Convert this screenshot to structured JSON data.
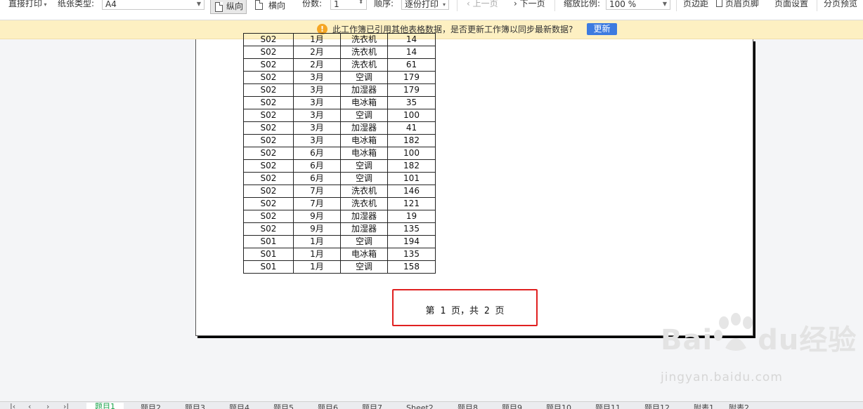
{
  "toolbar": {
    "print_direct": "直接打印",
    "paper_type_label": "纸张类型:",
    "paper_type_value": "A4",
    "portrait": "纵向",
    "landscape": "横向",
    "copies_label": "份数:",
    "copies_value": "1",
    "order_label": "顺序:",
    "order_value": "逐份打印",
    "prev_page": "上一页",
    "next_page": "下一页",
    "zoom_label": "缩放比例:",
    "zoom_value": "100 %",
    "margins": "页边距",
    "header_footer": "页眉页脚",
    "page_setup": "页面设置",
    "page_break_preview": "分页预览"
  },
  "notification": {
    "icon": "warning-circle-icon",
    "message": "此工作簿已引用其他表格数据，是否更新工作簿以同步最新数据?",
    "button": "更新"
  },
  "table": {
    "rows": [
      [
        "S02",
        "1月",
        "洗衣机",
        "14"
      ],
      [
        "S02",
        "2月",
        "洗衣机",
        "14"
      ],
      [
        "S02",
        "2月",
        "洗衣机",
        "61"
      ],
      [
        "S02",
        "3月",
        "空调",
        "179"
      ],
      [
        "S02",
        "3月",
        "加湿器",
        "179"
      ],
      [
        "S02",
        "3月",
        "电冰箱",
        "35"
      ],
      [
        "S02",
        "3月",
        "空调",
        "100"
      ],
      [
        "S02",
        "3月",
        "加湿器",
        "41"
      ],
      [
        "S02",
        "3月",
        "电冰箱",
        "182"
      ],
      [
        "S02",
        "6月",
        "电冰箱",
        "100"
      ],
      [
        "S02",
        "6月",
        "空调",
        "182"
      ],
      [
        "S02",
        "6月",
        "空调",
        "101"
      ],
      [
        "S02",
        "7月",
        "洗衣机",
        "146"
      ],
      [
        "S02",
        "7月",
        "洗衣机",
        "121"
      ],
      [
        "S02",
        "9月",
        "加湿器",
        "19"
      ],
      [
        "S02",
        "9月",
        "加湿器",
        "135"
      ],
      [
        "S01",
        "1月",
        "空调",
        "194"
      ],
      [
        "S01",
        "1月",
        "电冰箱",
        "135"
      ],
      [
        "S01",
        "1月",
        "空调",
        "158"
      ]
    ]
  },
  "footer": {
    "page_indicator": "第 1 页，共 2 页"
  },
  "watermark": {
    "brand": "Bai",
    "brand2": "du",
    "brand_cn": "经验",
    "url": "jingyan.baidu.com"
  },
  "sheet_tabs": {
    "tabs": [
      "题目1",
      "题目2",
      "题目3",
      "题目4",
      "题目5",
      "题目6",
      "题目7",
      "Sheet2",
      "题目8",
      "题目9",
      "题目10",
      "题目11",
      "题目12",
      "附表1",
      "附表2"
    ],
    "active_index": 0
  },
  "colors": {
    "accent_green": "#19a34a",
    "notify_bg": "#fdf0c2",
    "update_button": "#3d7be0",
    "highlight_box": "#e02020"
  }
}
